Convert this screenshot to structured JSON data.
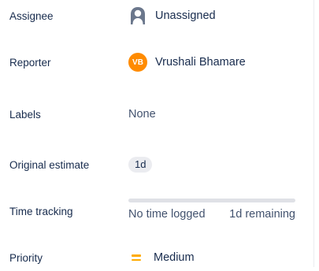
{
  "fields": {
    "assignee": {
      "label": "Assignee",
      "value": "Unassigned"
    },
    "reporter": {
      "label": "Reporter",
      "initials": "VB",
      "name": "Vrushali Bhamare",
      "avatar_color": "#ff8b00"
    },
    "labels": {
      "label": "Labels",
      "value": "None"
    },
    "original_estimate": {
      "label": "Original estimate",
      "value": "1d"
    },
    "time_tracking": {
      "label": "Time tracking",
      "logged": "No time logged",
      "remaining": "1d remaining",
      "progress_fraction": 0
    },
    "priority": {
      "label": "Priority",
      "value": "Medium",
      "icon": "priority-medium-icon",
      "icon_color": "#ffab00"
    }
  }
}
